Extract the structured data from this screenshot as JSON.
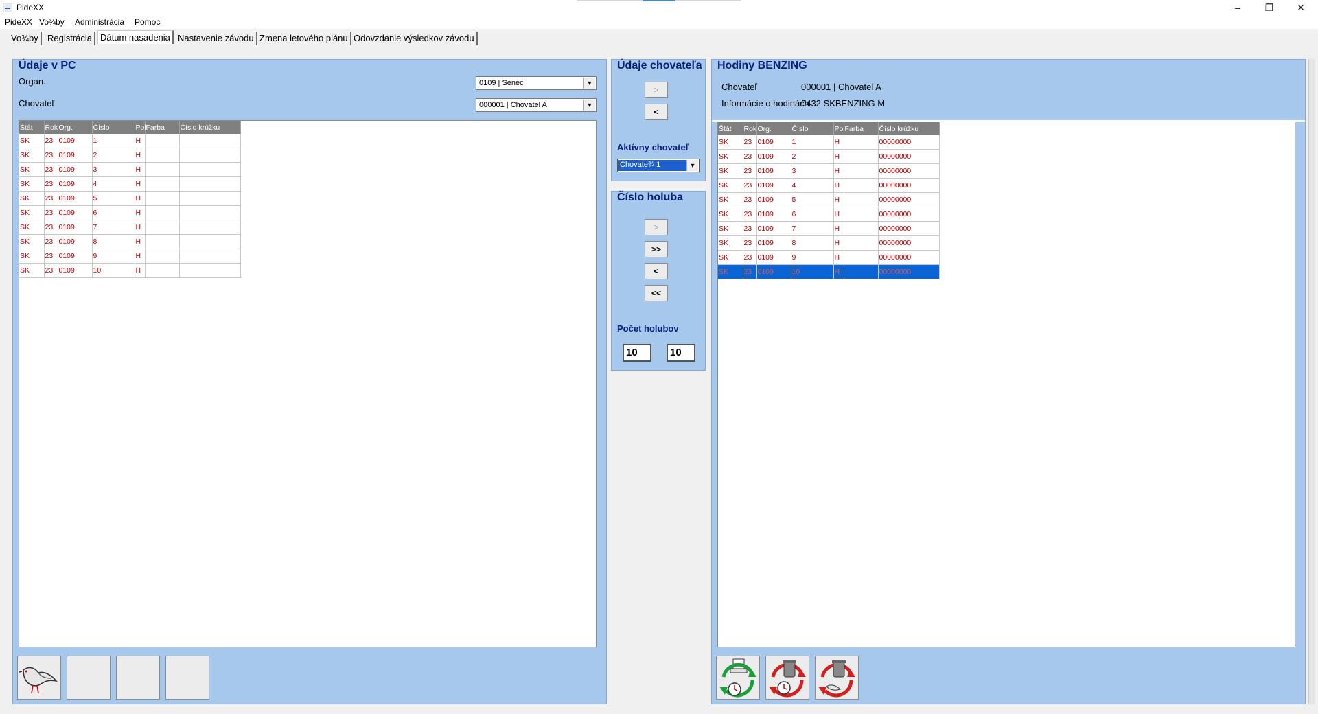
{
  "window": {
    "title": "PideXX",
    "minimize": "–",
    "restore": "❐",
    "close": "✕"
  },
  "menu": [
    "PideXX",
    "Vo¾by",
    "Administrácia",
    "Pomoc"
  ],
  "tabs": [
    {
      "label": "Vo¾by"
    },
    {
      "label": "Registrácia"
    },
    {
      "label": "Dátum nasadenia"
    },
    {
      "label": "Nastavenie závodu"
    },
    {
      "label": "Zmena letového plánu"
    },
    {
      "label": "Odovzdanie výsledkov závodu"
    }
  ],
  "left_panel": {
    "title": "Údaje v PC",
    "organ_label": "Organ.",
    "organ_value": "0109 | Senec",
    "breeder_label": "Chovateľ",
    "breeder_value": "000001 | Chovatel A",
    "columns": [
      "Štát",
      "Rok",
      "Org.",
      "Číslo",
      "Pol",
      "Farba",
      "Číslo krúžku"
    ],
    "rows": [
      [
        "SK",
        "23",
        "0109",
        "1",
        "H",
        "",
        ""
      ],
      [
        "SK",
        "23",
        "0109",
        "2",
        "H",
        "",
        ""
      ],
      [
        "SK",
        "23",
        "0109",
        "3",
        "H",
        "",
        ""
      ],
      [
        "SK",
        "23",
        "0109",
        "4",
        "H",
        "",
        ""
      ],
      [
        "SK",
        "23",
        "0109",
        "5",
        "H",
        "",
        ""
      ],
      [
        "SK",
        "23",
        "0109",
        "6",
        "H",
        "",
        ""
      ],
      [
        "SK",
        "23",
        "0109",
        "7",
        "H",
        "",
        ""
      ],
      [
        "SK",
        "23",
        "0109",
        "8",
        "H",
        "",
        ""
      ],
      [
        "SK",
        "23",
        "0109",
        "9",
        "H",
        "",
        ""
      ],
      [
        "SK",
        "23",
        "0109",
        "10",
        "H",
        "",
        ""
      ]
    ]
  },
  "middle_top": {
    "title": "Údaje chovateľa",
    "btn_right": ">",
    "btn_left": "<",
    "active_label": "Aktívny chovateľ",
    "active_value": "Chovate¾ 1"
  },
  "middle_bottom": {
    "title": "Číslo holuba",
    "btn_right": ">",
    "btn_all_right": ">>",
    "btn_left": "<",
    "btn_all_left": "<<",
    "count_label": "Počet holubov",
    "count_left": "10",
    "count_right": "10"
  },
  "right_panel": {
    "title": "Hodiny BENZING",
    "breeder_label": "Chovateľ",
    "breeder_value": "000001 | Chovatel A",
    "info_label": "Informácie o hodinách",
    "info_value": "0432 SKBENZING M",
    "columns": [
      "Štát",
      "Rok",
      "Org.",
      "Číslo",
      "Pol",
      "Farba",
      "Číslo krúžku"
    ],
    "rows": [
      [
        "SK",
        "23",
        "0109",
        "1",
        "H",
        "",
        "00000000"
      ],
      [
        "SK",
        "23",
        "0109",
        "2",
        "H",
        "",
        "00000000"
      ],
      [
        "SK",
        "23",
        "0109",
        "3",
        "H",
        "",
        "00000000"
      ],
      [
        "SK",
        "23",
        "0109",
        "4",
        "H",
        "",
        "00000000"
      ],
      [
        "SK",
        "23",
        "0109",
        "5",
        "H",
        "",
        "00000000"
      ],
      [
        "SK",
        "23",
        "0109",
        "6",
        "H",
        "",
        "00000000"
      ],
      [
        "SK",
        "23",
        "0109",
        "7",
        "H",
        "",
        "00000000"
      ],
      [
        "SK",
        "23",
        "0109",
        "8",
        "H",
        "",
        "00000000"
      ],
      [
        "SK",
        "23",
        "0109",
        "9",
        "H",
        "",
        "00000000"
      ],
      [
        "SK",
        "23",
        "0109",
        "10",
        "H",
        "",
        "00000000"
      ]
    ],
    "selected_row": 9
  },
  "left_toolbar_icons": [
    "pigeon-icon",
    "blank",
    "blank",
    "blank"
  ],
  "right_toolbar_icons": [
    "sync-clock-icon",
    "delete-clock-icon",
    "delete-clock-pigeon-icon"
  ]
}
